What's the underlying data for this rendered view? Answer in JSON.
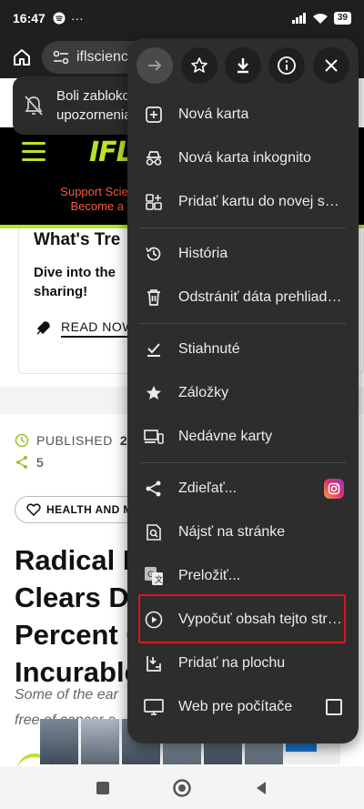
{
  "status_bar": {
    "time": "16:47",
    "battery": "39"
  },
  "browser": {
    "url": "iflscience"
  },
  "toast": {
    "line1": "Boli zabloko",
    "line2": "upozornenia"
  },
  "site": {
    "logo": "IFL",
    "support_line1": "Support Science",
    "support_line2": "Become a m"
  },
  "card": {
    "title": "What's Tre",
    "desc_line1": "Dive into the",
    "desc_line2": "sharing!",
    "read_now": "READ NOW"
  },
  "article": {
    "published_label": "PUBLISHED",
    "published_value": "2 H",
    "shares": "5",
    "tag": "HEALTH AND M",
    "headline_lines": [
      "Radical N",
      "Clears Di",
      "Percent C",
      "Incurable"
    ],
    "excerpt_line1": "Some of the ear",
    "excerpt_line2": "free of cancer a"
  },
  "ad": {
    "brand_letter": "C."
  },
  "menu": {
    "items": [
      {
        "label": "Nová karta",
        "icon": "new-tab-icon"
      },
      {
        "label": "Nová karta inkognito",
        "icon": "incognito-icon"
      },
      {
        "label": "Pridať kartu do novej sk...",
        "icon": "tab-group-icon"
      },
      {
        "label": "História",
        "icon": "history-icon"
      },
      {
        "label": "Odstrániť dáta prehliada...",
        "icon": "trash-icon"
      },
      {
        "label": "Stiahnuté",
        "icon": "downloads-icon"
      },
      {
        "label": "Záložky",
        "icon": "star-icon"
      },
      {
        "label": "Nedávne karty",
        "icon": "devices-icon"
      },
      {
        "label": "Zdieľať...",
        "icon": "share-icon"
      },
      {
        "label": "Nájsť na stránke",
        "icon": "find-icon"
      },
      {
        "label": "Preložiť...",
        "icon": "translate-icon"
      },
      {
        "label": "Vypočuť obsah tejto strá...",
        "icon": "play-icon"
      },
      {
        "label": "Pridať na plochu",
        "icon": "add-home-icon"
      },
      {
        "label": "Web pre počítače",
        "icon": "desktop-icon"
      }
    ]
  },
  "colors": {
    "accent_green": "#b7e32a",
    "highlight_red": "#e0141a",
    "menu_bg": "#2d2d2d"
  }
}
